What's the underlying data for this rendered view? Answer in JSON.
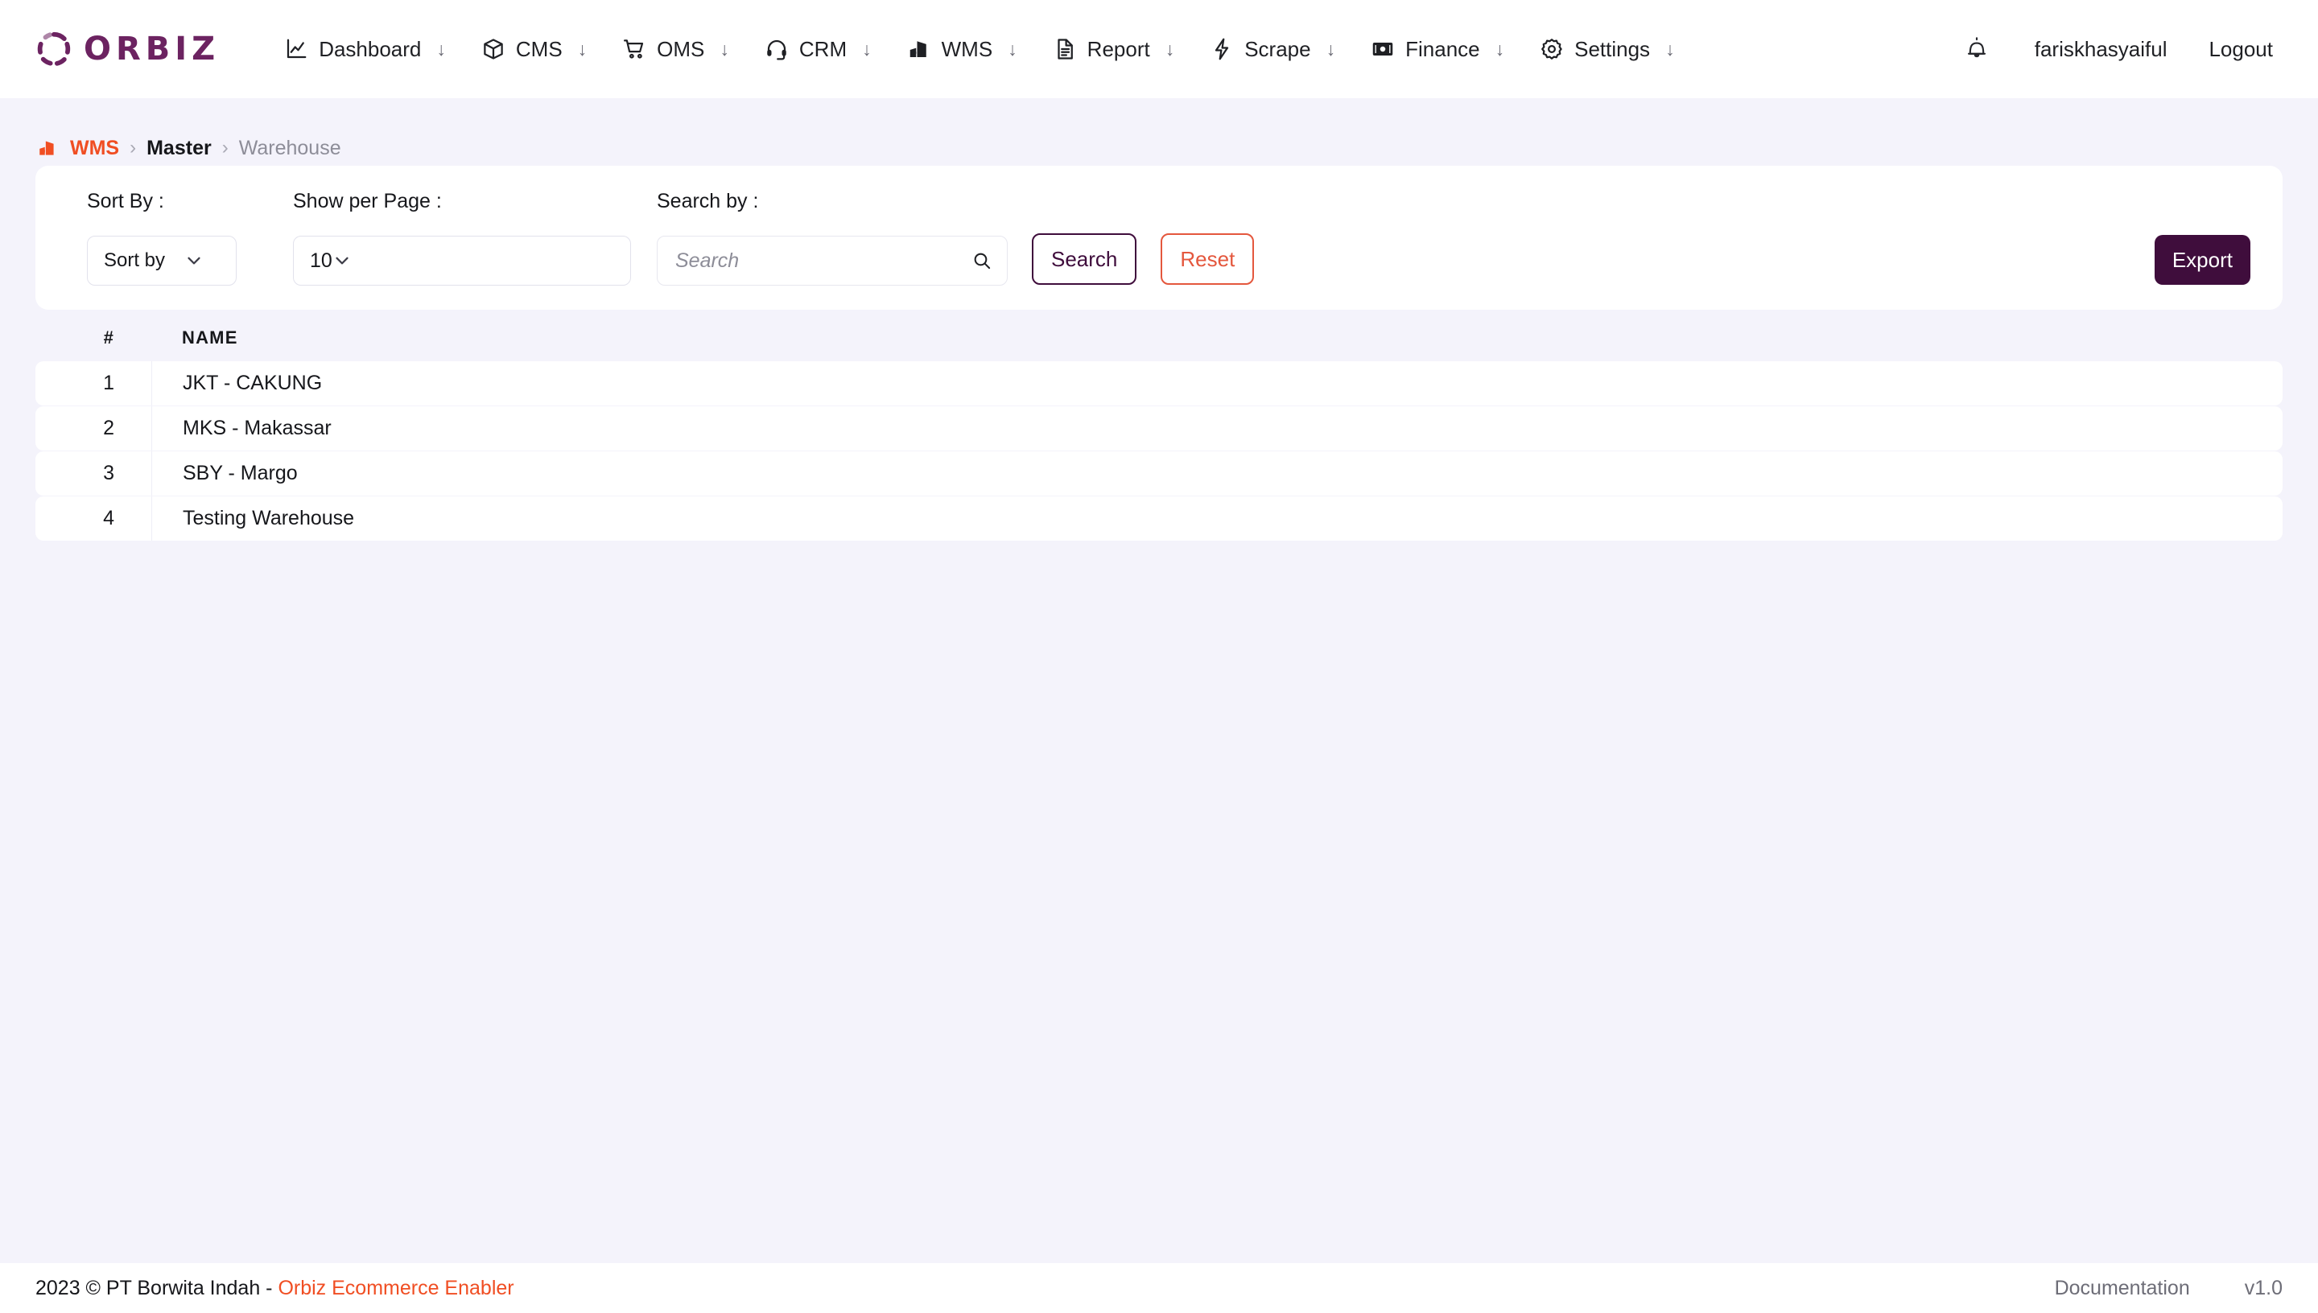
{
  "brand": {
    "logo_text": "ORBIZ",
    "logo_icon": "orbiz-ring-logo",
    "primary": "#3f0d3c",
    "logo_purple": "#6c2361",
    "accent_orange": "#f04e23",
    "reset_red": "#e4573d",
    "page_bg": "#f4f3fb"
  },
  "nav": {
    "items": [
      {
        "label": "Dashboard",
        "icon": "chart-line-icon",
        "caret": "↓"
      },
      {
        "label": "CMS",
        "icon": "box-3d-icon",
        "caret": "↓"
      },
      {
        "label": "OMS",
        "icon": "shopping-cart-icon",
        "caret": "↓"
      },
      {
        "label": "CRM",
        "icon": "headset-icon",
        "caret": "↓"
      },
      {
        "label": "WMS",
        "icon": "warehouse-building-icon",
        "caret": "↓"
      },
      {
        "label": "Report",
        "icon": "document-lines-icon",
        "caret": "↓"
      },
      {
        "label": "Scrape",
        "icon": "lightning-bolt-icon",
        "caret": "↓"
      },
      {
        "label": "Finance",
        "icon": "money-bill-icon",
        "caret": "↓"
      },
      {
        "label": "Settings",
        "icon": "gear-icon",
        "caret": "↓"
      }
    ],
    "notification_icon": "bell-icon",
    "username": "fariskhasyaiful",
    "logout_label": "Logout"
  },
  "breadcrumb": {
    "icon": "warehouse-building-icon",
    "root": "WMS",
    "separator": "›",
    "middle": "Master",
    "current": "Warehouse"
  },
  "filters": {
    "sort_label": "Sort By :",
    "sort_value": "Sort by",
    "per_page_label": "Show per Page :",
    "per_page_value": "10",
    "search_label": "Search by :",
    "search_value": "",
    "search_placeholder": "Search",
    "search_icon": "magnifier-icon",
    "search_button": "Search",
    "reset_button": "Reset",
    "export_button": "Export"
  },
  "table": {
    "columns": [
      "#",
      "NAME"
    ],
    "rows": [
      {
        "index": "1",
        "name": "JKT - CAKUNG"
      },
      {
        "index": "2",
        "name": "MKS - Makassar"
      },
      {
        "index": "3",
        "name": "SBY - Margo"
      },
      {
        "index": "4",
        "name": "Testing Warehouse"
      }
    ]
  },
  "footer": {
    "copyright": "2023 © PT Borwita Indah - ",
    "brand_link": "Orbiz Ecommerce Enabler",
    "documentation": "Documentation",
    "version": "v1.0"
  }
}
